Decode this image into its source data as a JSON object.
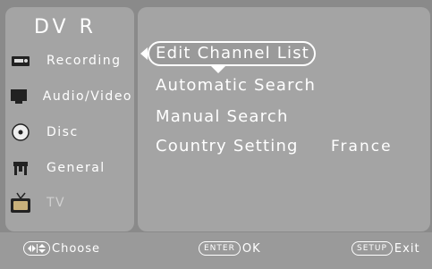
{
  "brand": "DV R",
  "sidebar": {
    "items": [
      {
        "label": "Recording",
        "icon": "recorder-icon"
      },
      {
        "label": "Audio/Video",
        "icon": "monitor-icon"
      },
      {
        "label": "Disc",
        "icon": "disc-icon"
      },
      {
        "label": "General",
        "icon": "toolbox-icon"
      },
      {
        "label": "TV",
        "icon": "tv-icon"
      }
    ]
  },
  "menu": {
    "items": [
      {
        "label": "Edit Channel List"
      },
      {
        "label": "Automatic Search"
      },
      {
        "label": "Manual Search"
      },
      {
        "label": "Country Setting",
        "value": "France"
      }
    ],
    "selected_index": 0
  },
  "footer": {
    "choose_label": "Choose",
    "enter_key": "ENTER",
    "ok_label": "OK",
    "setup_key": "SETUP",
    "exit_label": "Exit"
  },
  "colors": {
    "background": "#8a8a8a",
    "panel": "#a4a4a4",
    "text": "#ffffff"
  }
}
